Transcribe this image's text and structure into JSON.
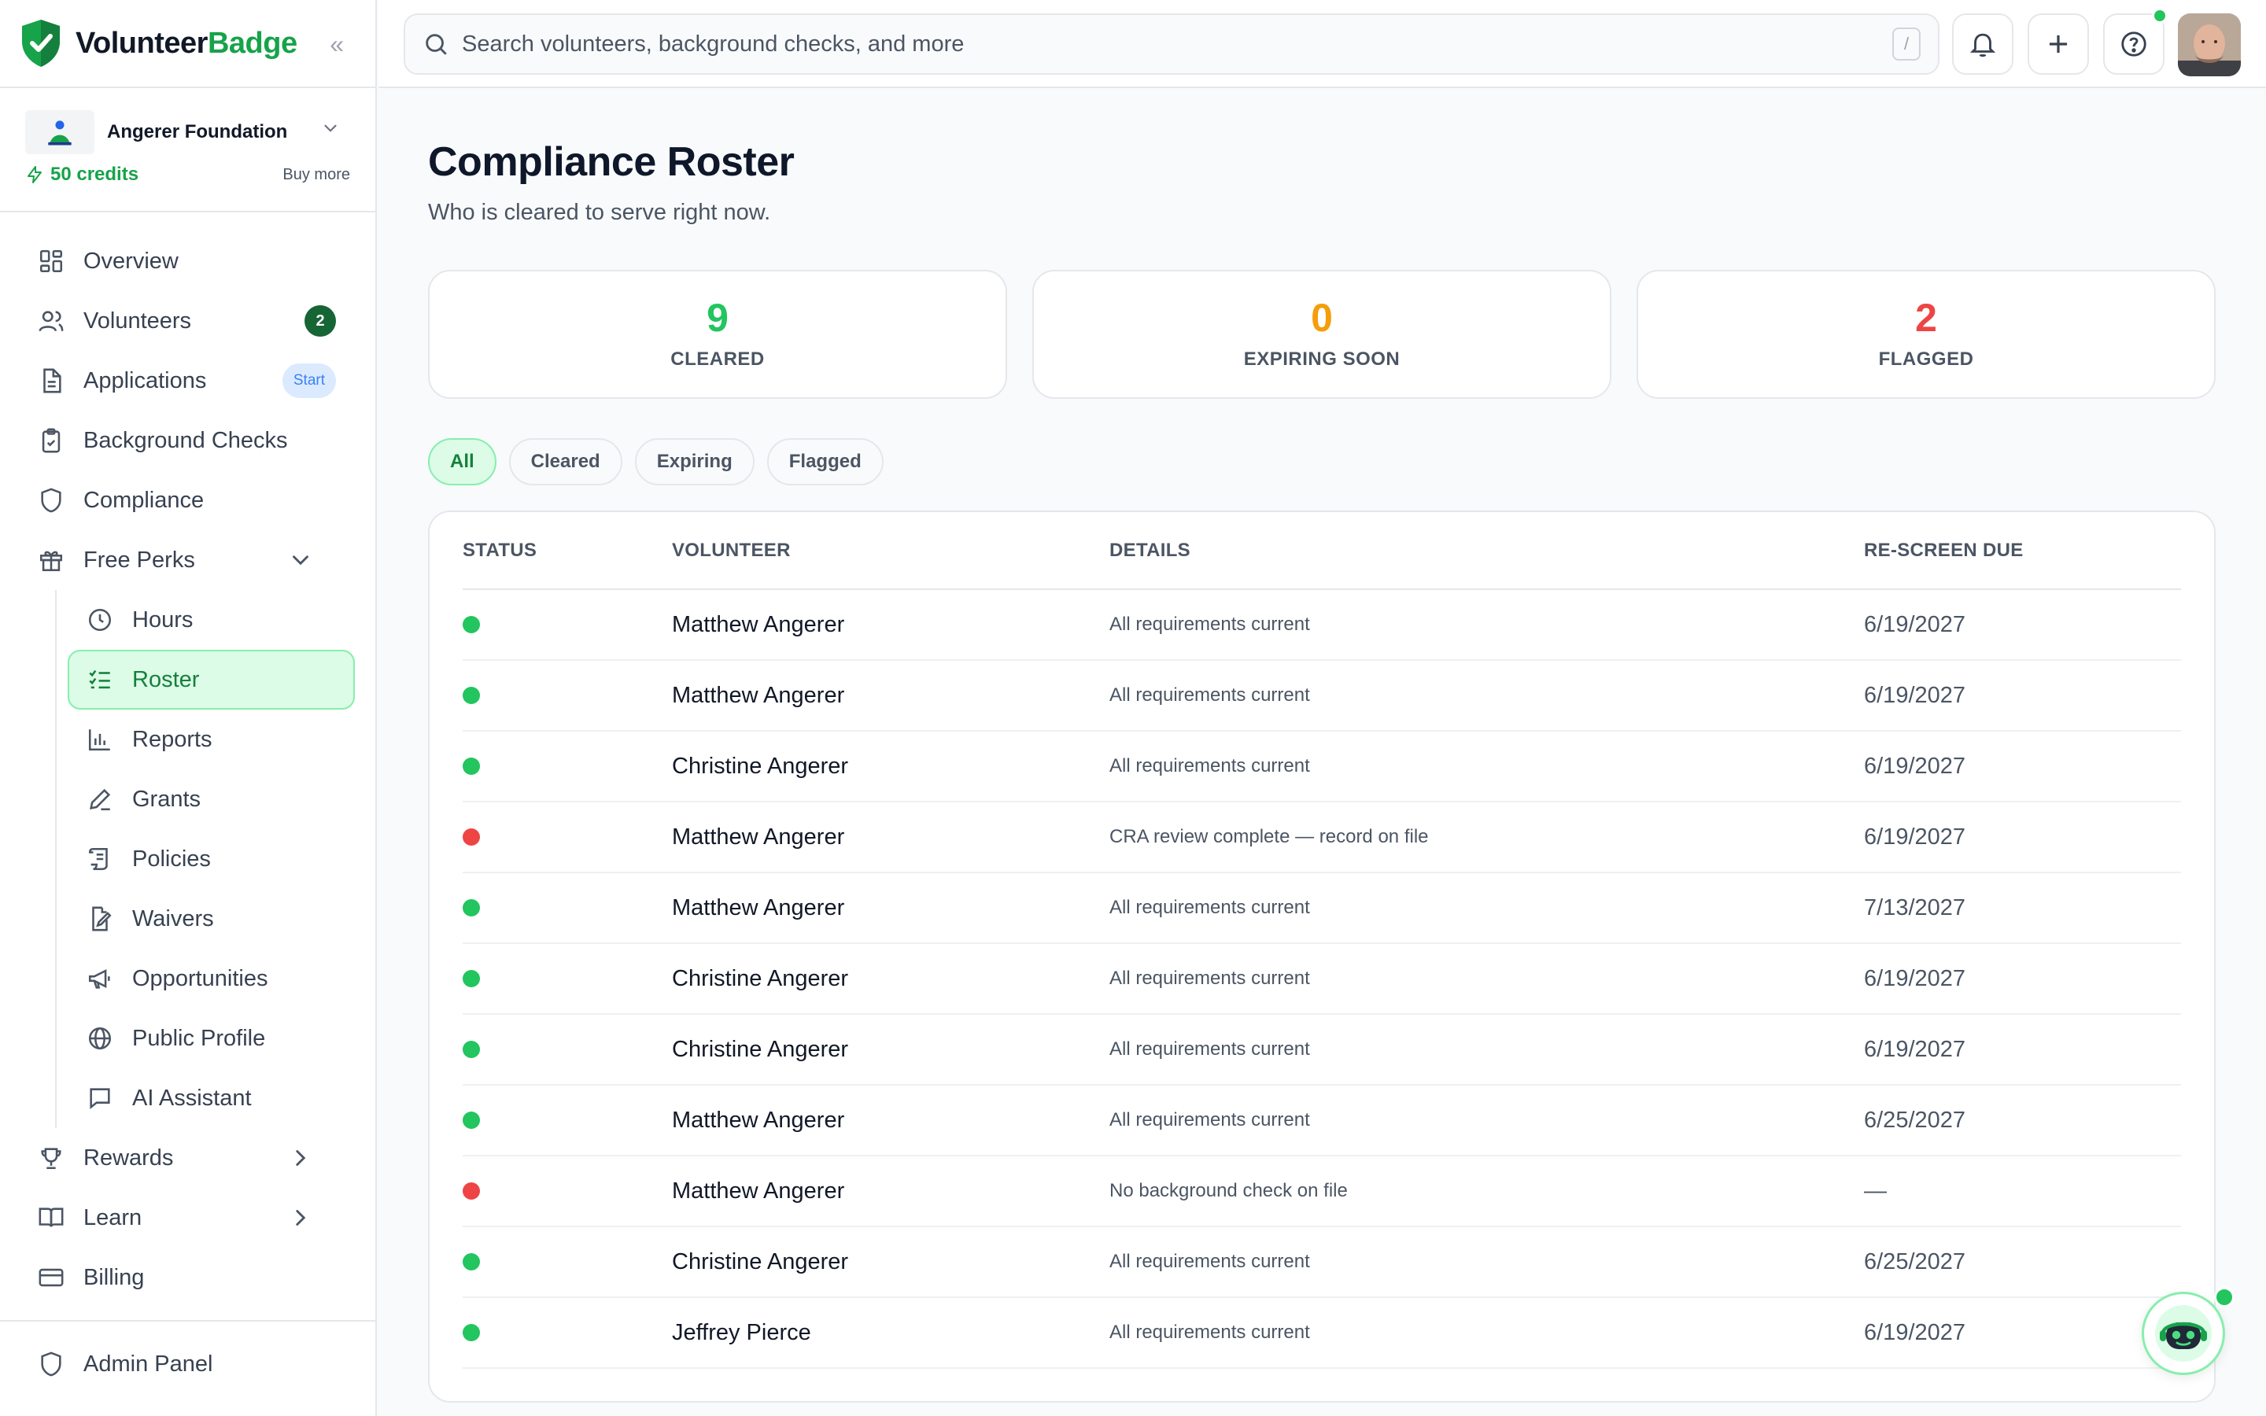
{
  "brand": {
    "name_part1": "Volunteer",
    "name_part2": "Badge"
  },
  "org": {
    "name": "Angerer Foundation",
    "credits": "50 credits",
    "buy_more": "Buy more"
  },
  "search": {
    "placeholder": "Search volunteers, background checks, and more",
    "shortcut": "/"
  },
  "sidebar": {
    "items": [
      {
        "label": "Overview",
        "icon": "grid-icon"
      },
      {
        "label": "Volunteers",
        "icon": "users-icon",
        "badge": "2"
      },
      {
        "label": "Applications",
        "icon": "document-icon",
        "badge": "Start"
      },
      {
        "label": "Background Checks",
        "icon": "clipboard-check-icon"
      },
      {
        "label": "Compliance",
        "icon": "shield-icon"
      },
      {
        "label": "Free Perks",
        "icon": "gift-icon"
      }
    ],
    "perks": [
      {
        "label": "Hours",
        "icon": "clock-icon"
      },
      {
        "label": "Roster",
        "icon": "checklist-icon"
      },
      {
        "label": "Reports",
        "icon": "bar-chart-icon"
      },
      {
        "label": "Grants",
        "icon": "pencil-icon"
      },
      {
        "label": "Policies",
        "icon": "scroll-icon"
      },
      {
        "label": "Waivers",
        "icon": "file-signature-icon"
      },
      {
        "label": "Opportunities",
        "icon": "megaphone-icon"
      },
      {
        "label": "Public Profile",
        "icon": "globe-icon"
      },
      {
        "label": "AI Assistant",
        "icon": "chat-icon"
      }
    ],
    "after": [
      {
        "label": "Rewards",
        "icon": "trophy-icon"
      },
      {
        "label": "Learn",
        "icon": "book-icon"
      },
      {
        "label": "Billing",
        "icon": "credit-card-icon"
      }
    ],
    "footer": {
      "label": "Admin Panel",
      "icon": "shield-icon"
    }
  },
  "page": {
    "title": "Compliance Roster",
    "subtitle": "Who is cleared to serve right now."
  },
  "stats": [
    {
      "value": "9",
      "label": "CLEARED",
      "color": "#22c55e"
    },
    {
      "value": "0",
      "label": "EXPIRING SOON",
      "color": "#f59e0b"
    },
    {
      "value": "2",
      "label": "FLAGGED",
      "color": "#ef4444"
    }
  ],
  "filters": [
    "All",
    "Cleared",
    "Expiring",
    "Flagged"
  ],
  "table": {
    "headers": [
      "STATUS",
      "VOLUNTEER",
      "DETAILS",
      "RE-SCREEN DUE"
    ],
    "rows": [
      {
        "status": "cleared",
        "volunteer": "Matthew Angerer",
        "details": "All requirements current",
        "due": "6/19/2027"
      },
      {
        "status": "cleared",
        "volunteer": "Matthew Angerer",
        "details": "All requirements current",
        "due": "6/19/2027"
      },
      {
        "status": "cleared",
        "volunteer": "Christine Angerer",
        "details": "All requirements current",
        "due": "6/19/2027"
      },
      {
        "status": "flagged",
        "volunteer": "Matthew Angerer",
        "details": "CRA review complete — record on file",
        "due": "6/19/2027"
      },
      {
        "status": "cleared",
        "volunteer": "Matthew Angerer",
        "details": "All requirements current",
        "due": "7/13/2027"
      },
      {
        "status": "cleared",
        "volunteer": "Christine Angerer",
        "details": "All requirements current",
        "due": "6/19/2027"
      },
      {
        "status": "cleared",
        "volunteer": "Christine Angerer",
        "details": "All requirements current",
        "due": "6/19/2027"
      },
      {
        "status": "cleared",
        "volunteer": "Matthew Angerer",
        "details": "All requirements current",
        "due": "6/25/2027"
      },
      {
        "status": "flagged",
        "volunteer": "Matthew Angerer",
        "details": "No background check on file",
        "due": "—"
      },
      {
        "status": "cleared",
        "volunteer": "Christine Angerer",
        "details": "All requirements current",
        "due": "6/25/2027"
      },
      {
        "status": "cleared",
        "volunteer": "Jeffrey Pierce",
        "details": "All requirements current",
        "due": "6/19/2027"
      }
    ]
  },
  "colors": {
    "accent": "#16a34a",
    "cleared": "#22c55e",
    "flagged": "#ef4444",
    "expiring": "#f59e0b"
  }
}
